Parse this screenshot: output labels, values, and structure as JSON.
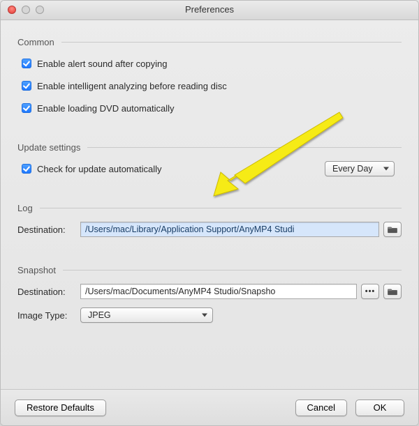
{
  "window": {
    "title": "Preferences"
  },
  "common": {
    "legend": "Common",
    "alert_sound": {
      "label": "Enable alert sound after copying",
      "checked": true
    },
    "intelligent_analyze": {
      "label": "Enable intelligent analyzing before reading disc",
      "checked": true
    },
    "load_dvd": {
      "label": "Enable loading DVD automatically",
      "checked": true
    }
  },
  "update": {
    "legend": "Update settings",
    "auto_check": {
      "label": "Check for update automatically",
      "checked": true
    },
    "frequency": "Every Day"
  },
  "log": {
    "legend": "Log",
    "dest_label": "Destination:",
    "destination": "/Users/mac/Library/Application Support/AnyMP4 Studi"
  },
  "snapshot": {
    "legend": "Snapshot",
    "dest_label": "Destination:",
    "destination": "/Users/mac/Documents/AnyMP4 Studio/Snapsho",
    "image_type_label": "Image Type:",
    "image_type": "JPEG"
  },
  "buttons": {
    "restore": "Restore Defaults",
    "cancel": "Cancel",
    "ok": "OK"
  },
  "annotation": {
    "arrow_color": "#f6eb16"
  }
}
